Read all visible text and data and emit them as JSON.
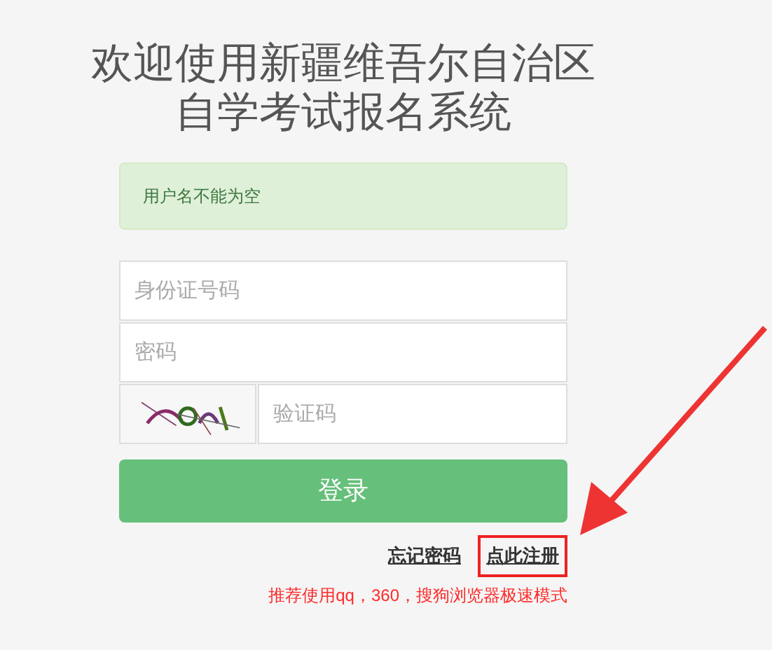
{
  "title_lines": [
    "欢迎使用新疆维吾尔自治区",
    "自学考试报名系统"
  ],
  "alert": "用户名不能为空",
  "fields": [
    {
      "kind": "text",
      "placeholder": "身份证号码"
    },
    {
      "kind": "text",
      "placeholder": "密码"
    },
    {
      "kind": "captcha",
      "placeholder": "验证码"
    }
  ],
  "login_button": "登录",
  "links": [
    {
      "label": "忘记密码",
      "highlighted": false
    },
    {
      "label": "点此注册",
      "highlighted": true
    }
  ],
  "note": "推荐使用qq，360，搜狗浏览器极速模式"
}
